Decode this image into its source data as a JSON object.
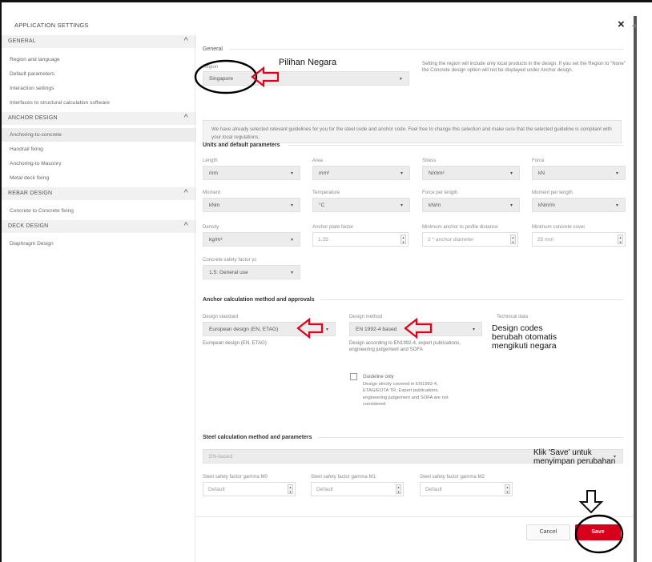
{
  "title": "APPLICATION SETTINGS",
  "close_icon": "×",
  "sidebar": {
    "general_label": "GENERAL",
    "general_items": [
      "Region and language",
      "Default parameters",
      "Interaction settings",
      "Interfaces to structural calculation software"
    ],
    "anchor_label": "ANCHOR DESIGN",
    "anchor_items": [
      "Anchoring-to-concrete",
      "Handrail fixing",
      "Anchoring-to Masonry",
      "Metal deck fixing"
    ],
    "rebar_label": "REBAR DESIGN",
    "rebar_items": [
      "Concrete to Concrete fixing"
    ],
    "deck_label": "DECK DESIGN",
    "deck_items": [
      "Diaphragm Design"
    ],
    "chevron": "^"
  },
  "general": {
    "title": "General",
    "region_label": "Region",
    "region_value": "Singapore",
    "region_note": "Setting the region will include only local products in the design. If you set the Region to \"None\" the Concrete design option will not be displayed under Anchor design.",
    "info_text": "We have already selected relevant guidelines for you for the steel code and anchor code. Feel free to change this selection and make sure that the selected guideline is compliant with your local regulations."
  },
  "units": {
    "title": "Units and default parameters",
    "row1": [
      {
        "label": "Length",
        "value": "mm"
      },
      {
        "label": "Area",
        "value": "mm²"
      },
      {
        "label": "Stress",
        "value": "N/mm²"
      },
      {
        "label": "Force",
        "value": "kN"
      }
    ],
    "row2": [
      {
        "label": "Moment",
        "value": "kNm"
      },
      {
        "label": "Temperature",
        "value": "°C"
      },
      {
        "label": "Force per length",
        "value": "kN/m"
      },
      {
        "label": "Moment per length",
        "value": "kNm/m"
      }
    ],
    "row3": [
      {
        "label": "Density",
        "value": "kg/m³"
      },
      {
        "label": "Anchor plate factor",
        "value": "1.25"
      },
      {
        "label": "Minimum anchor to profile distance",
        "value": "2 * anchor diameter"
      },
      {
        "label": "Minimum concrete cover",
        "value": "25 mm"
      }
    ],
    "safety_label": "Concrete safety factor γc",
    "safety_value": "1.5: General use"
  },
  "anchor_calc": {
    "title": "Anchor calculation method and approvals",
    "standard_label": "Design standard",
    "standard_value": "European design (EN, ETAG)",
    "standard_note": "European design (EN, ETAG)",
    "method_label": "Design method",
    "method_value": "EN 1992-4 based",
    "method_note": "Design according to EN1992-4, expert publications, engineering judgement and SOFA",
    "technical_label": "Technical data",
    "guideline_label": "Guideline only",
    "guideline_note": "Design strictly covered in EN1992-4, ETAG/EOTA TR, Expert publications, engineering judgement and SOFA are not considered"
  },
  "steel_calc": {
    "title": "Steel calculation method and parameters",
    "method_value": "EN-based",
    "m0_label": "Steel safety factor gamma M0",
    "m1_label": "Steel safety factor gamma M1",
    "m2_label": "Steel safety factor gamma M2",
    "m0_value": "Default",
    "m1_value": "Default",
    "m2_value": "Default"
  },
  "buttons": {
    "cancel": "Cancel",
    "save": "Save"
  },
  "annotations": {
    "country": "Pilihan Negara",
    "codes": "Design codes berubah otomatis mengikuti negara",
    "save": "Klik 'Save' untuk menyimpan perubahan"
  },
  "colors": {
    "accent": "#d6001c",
    "annotation": "#e4001b"
  }
}
